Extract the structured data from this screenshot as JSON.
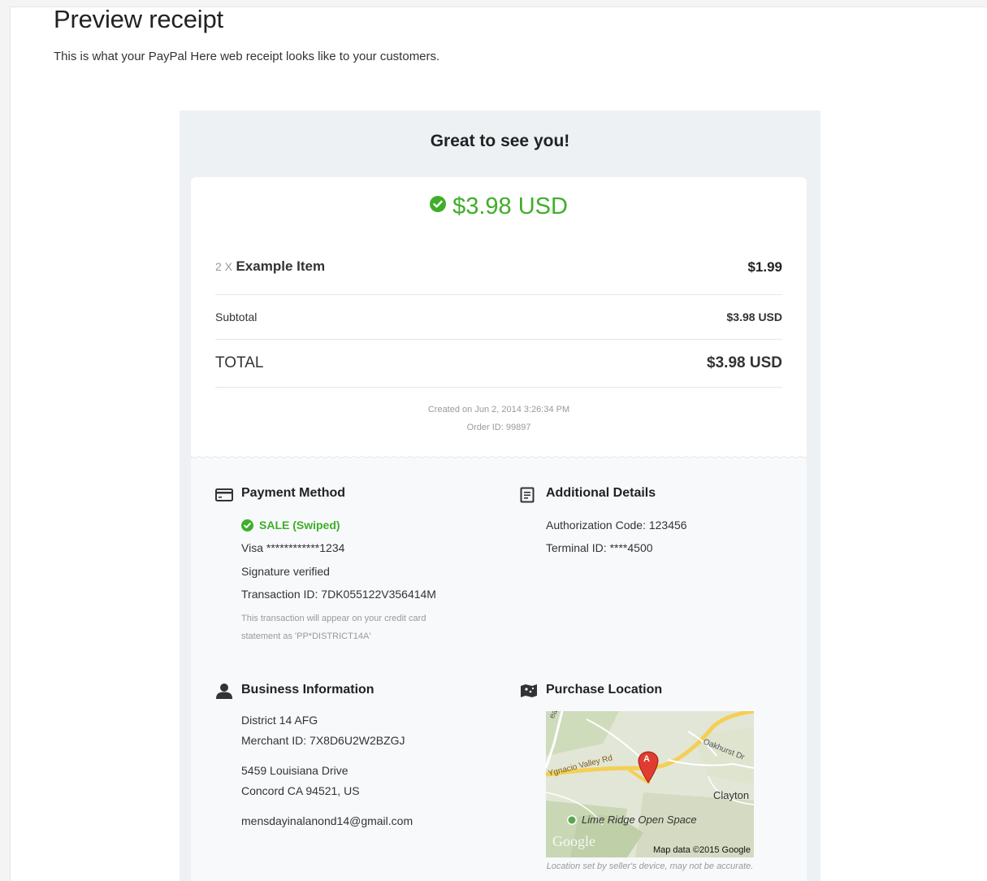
{
  "page": {
    "title": "Preview receipt",
    "subtitle": "This is what your PayPal Here web receipt looks like to your customers."
  },
  "receipt": {
    "greeting": "Great to see you!",
    "amount": "$3.98 USD",
    "item": {
      "qty": "2 X",
      "name": "Example Item",
      "price": "$1.99"
    },
    "subtotal": {
      "label": "Subtotal",
      "value": "$3.98 USD"
    },
    "total": {
      "label": "TOTAL",
      "value": "$3.98 USD"
    },
    "created": "Created on Jun 2, 2014 3:26:34 PM",
    "order_id": "Order ID: 99897",
    "accent_color": "#3fae29"
  },
  "payment_method": {
    "title": "Payment Method",
    "icon": "credit-card-icon",
    "status": "SALE (Swiped)",
    "card": "Visa ************1234",
    "signature": "Signature verified",
    "transaction": "Transaction ID: 7DK055122V356414M",
    "note_line1": "This transaction will appear on your credit card",
    "note_line2": "statement as 'PP*DISTRICT14A'"
  },
  "additional_details": {
    "title": "Additional Details",
    "icon": "document-icon",
    "auth_code": "Authorization Code: 123456",
    "terminal": "Terminal ID: ****4500"
  },
  "business_info": {
    "title": "Business Information",
    "icon": "person-icon",
    "name": "District 14 AFG",
    "merchant_id": "Merchant ID: 7X8D6U2W2BZGJ",
    "address1": "5459 Louisiana Drive",
    "address2": "Concord CA 94521, US",
    "email": "mensdayinalanond14@gmail.com"
  },
  "purchase_location": {
    "title": "Purchase Location",
    "icon": "map-icon",
    "map_labels": {
      "road_top": "ear Blvd",
      "valley": "Ygnacio Valley Rd",
      "oakhurst": "Oakhurst Dr",
      "clayton": "Clayton",
      "park": "Lime Ridge Open Space",
      "marker": "A",
      "google": "Google",
      "map_data": "Map data ©2015 Google"
    },
    "note": "Location set by seller's device, may not be accurate."
  }
}
